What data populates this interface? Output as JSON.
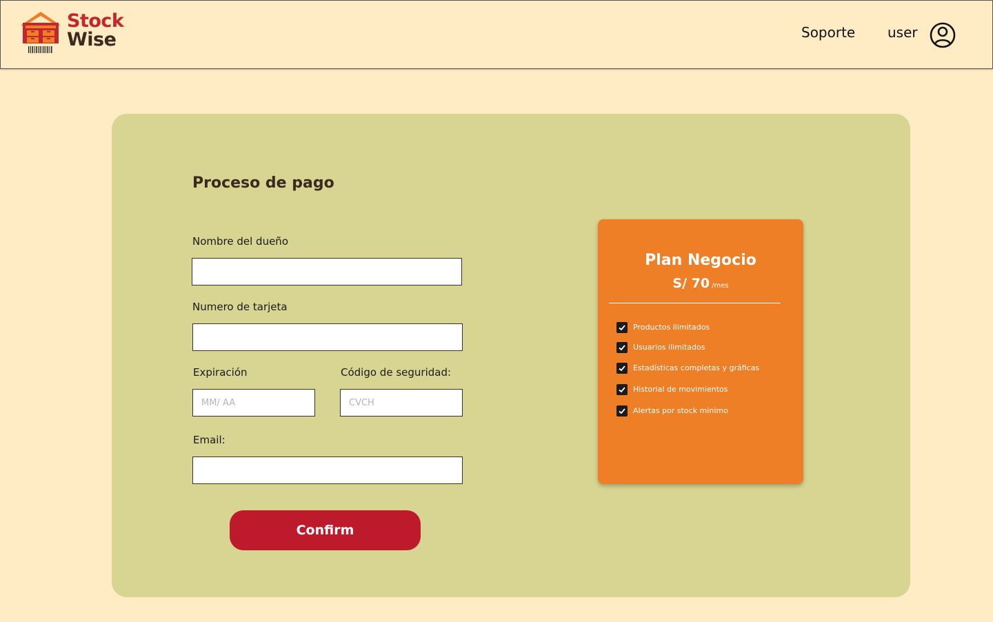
{
  "header": {
    "brand_line1": "Stock",
    "brand_line2": "Wise",
    "nav_support": "Soporte",
    "nav_user": "user",
    "user_icon": "user-circle-icon"
  },
  "form": {
    "title": "Proceso de pago",
    "owner_label": "Nombre del dueño",
    "owner_value": "",
    "card_label": "Numero de tarjeta",
    "card_value": "",
    "expiry_label": "Expiración",
    "expiry_placeholder": "MM/ AA",
    "security_label": "Código de seguridad:",
    "security_placeholder": "CVCH",
    "email_label": "Email:",
    "email_value": "",
    "confirm_label": "Confirm"
  },
  "plan": {
    "name": "Plan Negocio",
    "price": "S/ 70",
    "period": "/mes",
    "features": [
      "Productos ilimitados",
      "Usuarios ilimitados",
      "Estadísticas completas y gráficas",
      "Historial de movimientos",
      "Alertas por stock minimo"
    ],
    "check_icon": "checkbox-checked-icon"
  },
  "colors": {
    "page_bg": "#ffebc4",
    "panel_bg": "#d8d592",
    "plan_bg": "#ef7f27",
    "confirm_bg": "#bd1a2b",
    "brand_red": "#c4262e",
    "brand_dark": "#3d2a1e"
  }
}
